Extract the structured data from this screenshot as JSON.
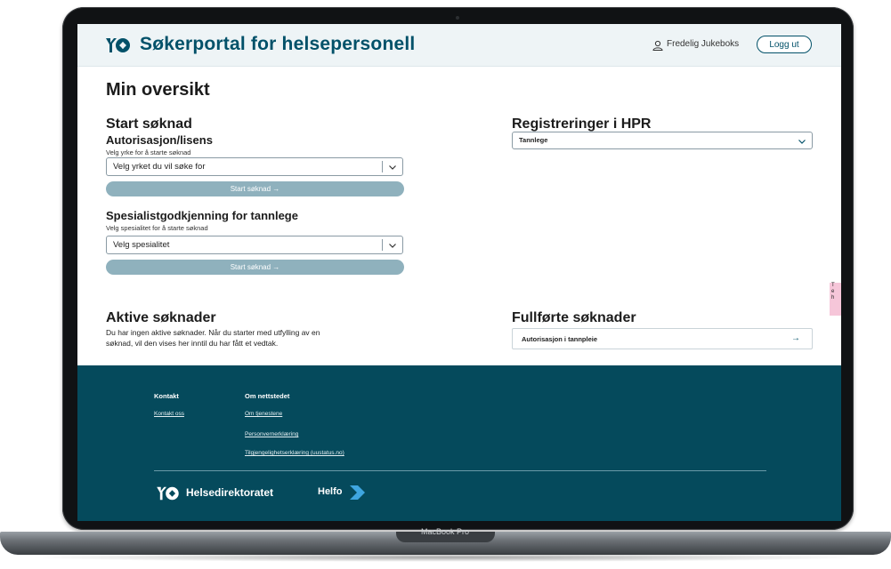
{
  "header": {
    "site_title": "Søkerportal for helsepersonell",
    "user_name": "Fredelig Jukeboks",
    "logout_label": "Logg ut"
  },
  "main": {
    "page_title": "Min oversikt",
    "start": {
      "heading": "Start søknad",
      "authorization": {
        "heading": "Autorisasjon/lisens",
        "select_label": "Velg yrke for å starte søknad",
        "select_value": "Velg yrket du vil søke for",
        "button_label": "Start søknad →"
      },
      "specialist": {
        "heading": "Spesialistgodkjenning for tannlege",
        "select_label": "Velg spesialitet for å starte søknad",
        "select_value": "Velg spesialitet",
        "button_label": "Start søknad →"
      }
    },
    "hpr": {
      "heading": "Registreringer i HPR",
      "select_value": "Tannlege"
    },
    "active": {
      "heading": "Aktive søknader",
      "text_line1": "Du har ingen aktive søknader. Når du starter med utfylling av en",
      "text_line2": "søknad, vil den vises her inntil du har fått et vedtak."
    },
    "completed": {
      "heading": "Fullførte søknader",
      "items": [
        {
          "label": "Autorisasjon i tannpleie",
          "arrow": "→"
        }
      ]
    },
    "side_tab": {
      "line1": "T",
      "line2": "e",
      "line3": "h"
    }
  },
  "footer": {
    "contact": {
      "heading": "Kontakt",
      "links": [
        "Kontakt oss"
      ]
    },
    "about": {
      "heading": "Om nettstedet",
      "links": [
        "Om tjenestene",
        "Personvernerklæring",
        "Tilgjengelighetserklæring (uustatus.no)"
      ]
    },
    "brand": "Helsedirektoratet",
    "partner": "Helfo"
  },
  "device": {
    "label": "MacBook Pro"
  },
  "colors": {
    "brand": "#025169",
    "footer_bg": "#054a5c",
    "button_disabled": "#8fb1bd",
    "header_bg": "#eef4f6"
  },
  "icons": [
    "helsedirektoratet-logo-icon",
    "user-icon",
    "chevron-down-icon",
    "arrow-right-icon",
    "helfo-logo-icon"
  ]
}
